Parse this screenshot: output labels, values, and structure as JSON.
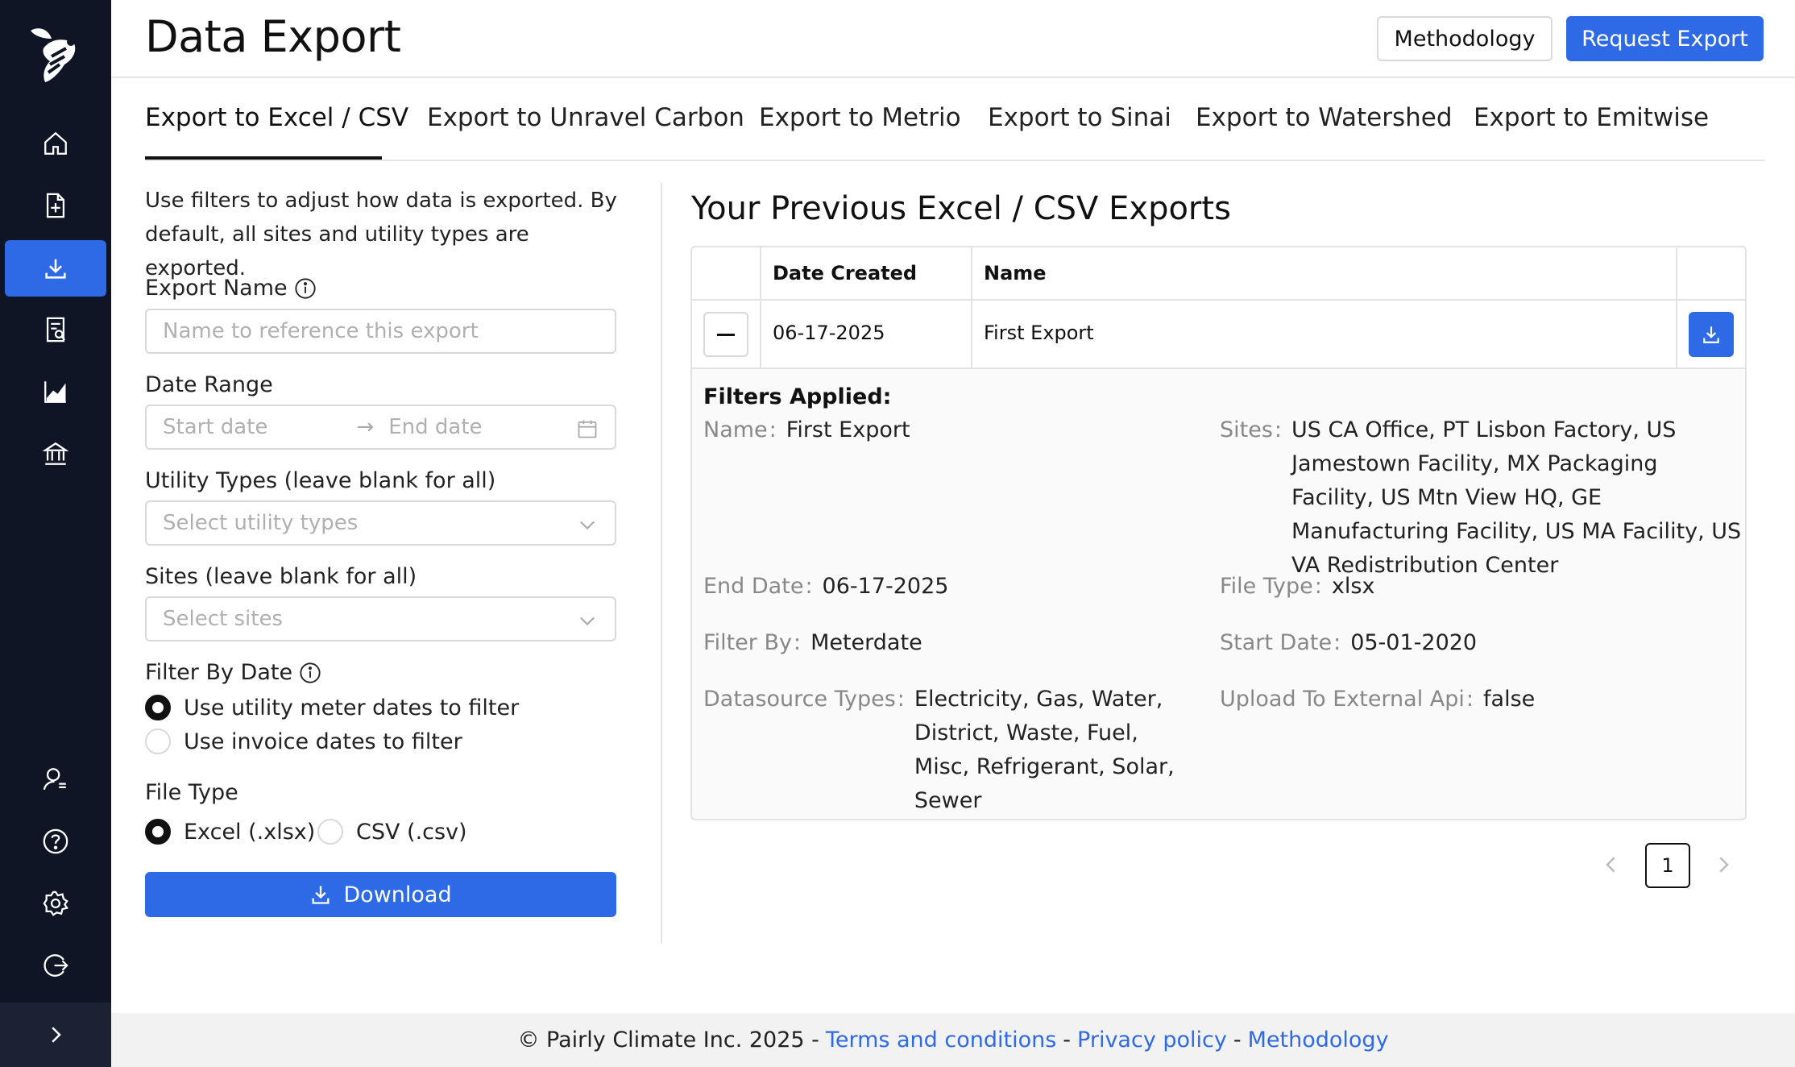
{
  "app": {
    "accent": "#2f6ae6",
    "sidebar_bg": "#0f1524"
  },
  "header": {
    "title": "Data Export",
    "methodology_label": "Methodology",
    "request_export_label": "Request Export"
  },
  "sidebar": {
    "items": [
      {
        "name": "home-icon"
      },
      {
        "name": "add-document-icon"
      },
      {
        "name": "download-icon",
        "active": true
      },
      {
        "name": "report-icon"
      },
      {
        "name": "chart-icon"
      },
      {
        "name": "bank-icon"
      },
      {
        "name": "user-settings-icon"
      },
      {
        "name": "help-icon"
      },
      {
        "name": "gear-icon"
      },
      {
        "name": "logout-icon"
      }
    ]
  },
  "tabs": [
    {
      "label": "Export to Excel / CSV",
      "active": true
    },
    {
      "label": "Export to Unravel Carbon"
    },
    {
      "label": "Export to Metrio"
    },
    {
      "label": "Export to Sinai"
    },
    {
      "label": "Export to Watershed"
    },
    {
      "label": "Export to Emitwise"
    }
  ],
  "form": {
    "intro": "Use filters to adjust how data is exported. By default, all sites and utility types are exported.",
    "export_name_label": "Export Name",
    "export_name_placeholder": "Name to reference this export",
    "date_range_label": "Date Range",
    "start_date_placeholder": "Start date",
    "end_date_placeholder": "End date",
    "utility_types_label": "Utility Types (leave blank for all)",
    "utility_types_placeholder": "Select utility types",
    "sites_label": "Sites (leave blank for all)",
    "sites_placeholder": "Select sites",
    "filter_by_date_label": "Filter By Date",
    "filter_options": [
      {
        "label": "Use utility meter dates to filter",
        "checked": true
      },
      {
        "label": "Use invoice dates to filter",
        "checked": false
      }
    ],
    "file_type_label": "File Type",
    "file_type_options": [
      {
        "label": "Excel (.xlsx)",
        "checked": true
      },
      {
        "label": "CSV (.csv)",
        "checked": false
      }
    ],
    "download_label": "Download"
  },
  "exports": {
    "title": "Your Previous Excel / CSV Exports",
    "columns": [
      "Date Created",
      "Name"
    ],
    "rows": [
      {
        "date_created": "06-17-2025",
        "name": "First Export"
      }
    ],
    "filters_title": "Filters Applied:",
    "filters": {
      "name": {
        "key": "Name",
        "value": "First Export"
      },
      "sites": {
        "key": "Sites",
        "value": "US CA Office, PT Lisbon Factory, US Jamestown Facility, MX Packaging Facility, US Mtn View HQ, GE Manufacturing Facility, US MA Facility, US VA Redistribution Center"
      },
      "end_date": {
        "key": "End Date",
        "value": "06-17-2025"
      },
      "file_type": {
        "key": "File Type",
        "value": "xlsx"
      },
      "filter_by": {
        "key": "Filter By",
        "value": "Meterdate"
      },
      "start_date": {
        "key": "Start Date",
        "value": "05-01-2020"
      },
      "datasource_types": {
        "key": "Datasource Types",
        "value": "Electricity, Gas, Water, District, Waste, Fuel, Misc, Refrigerant, Solar, Sewer"
      },
      "upload_external": {
        "key": "Upload To External Api",
        "value": "false"
      }
    },
    "pagination": {
      "current_page": "1"
    }
  },
  "footer": {
    "copyright": "© Pairly Climate Inc. 2025 -",
    "terms": "Terms and conditions",
    "privacy": "Privacy policy",
    "methodology": "Methodology",
    "separator": "-"
  }
}
